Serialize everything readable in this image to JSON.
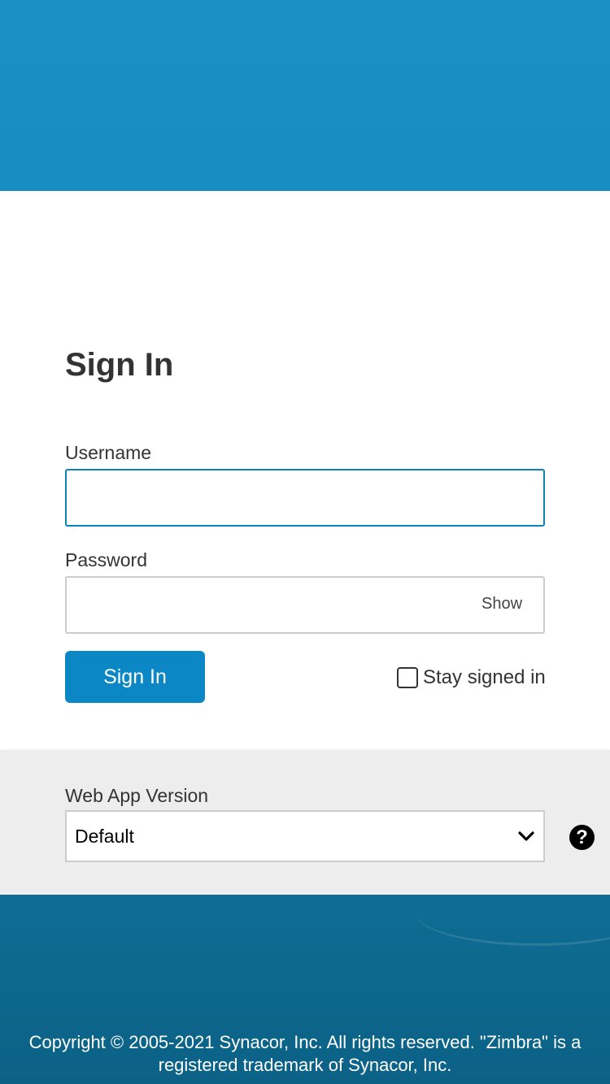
{
  "login": {
    "title": "Sign In",
    "username_label": "Username",
    "username_value": "",
    "password_label": "Password",
    "password_value": "",
    "show_label": "Show",
    "signin_button_label": "Sign In",
    "stay_signed_in_label": "Stay signed in",
    "stay_signed_in_checked": false
  },
  "version": {
    "label": "Web App Version",
    "selected": "Default",
    "help_glyph": "?"
  },
  "footer": {
    "copyright_line1": "Copyright © 2005-2021 Synacor, Inc. All rights reserved. \"Zimbra\" is a",
    "copyright_line2": "registered trademark of Synacor, Inc."
  },
  "colors": {
    "banner": "#168ec2",
    "primary_button": "#0a87c4",
    "focused_border": "#0c84ba",
    "footer_bg": "#0d6a90",
    "version_panel_bg": "#ededed"
  },
  "icons": {
    "select": "chevron-down-icon",
    "help": "help-icon",
    "checkbox": "checkbox-icon"
  }
}
